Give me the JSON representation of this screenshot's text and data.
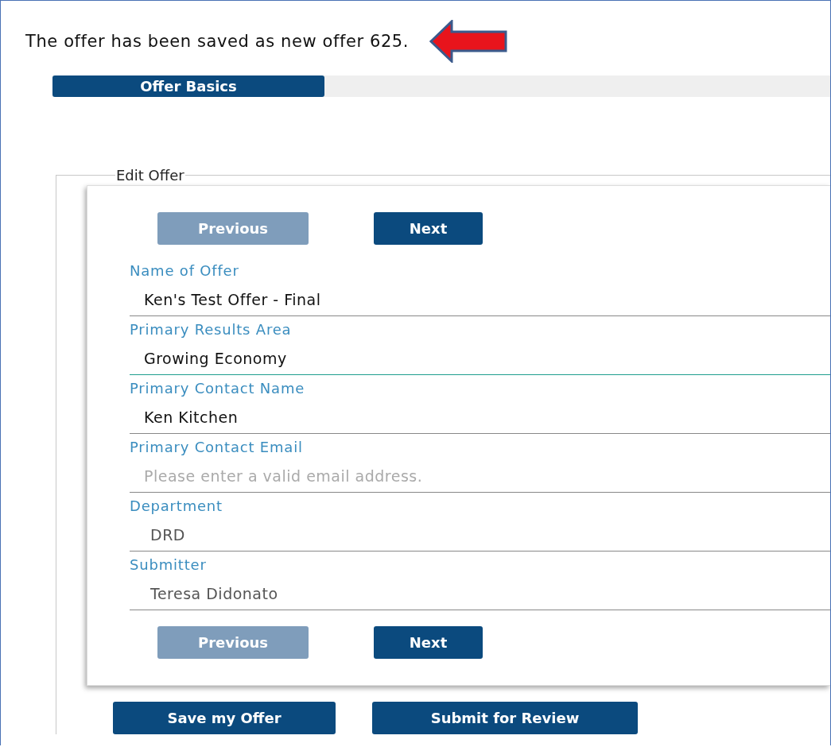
{
  "message": "The offer has been saved as new offer 625.",
  "tabs": [
    {
      "label": "Offer Basics",
      "selected": true
    }
  ],
  "form": {
    "legend": "Edit Offer",
    "top_nav": [
      {
        "label": "Previous",
        "disabled": true
      },
      {
        "label": "Next",
        "disabled": false
      }
    ],
    "fields": [
      {
        "label": "Name of Offer",
        "value": "Ken's Test Offer - Final",
        "focused": false,
        "disabled": false
      },
      {
        "label": "Primary Results Area",
        "value": "Growing Economy",
        "focused": true,
        "disabled": false
      },
      {
        "label": "Primary Contact Name",
        "value": "Ken Kitchen",
        "focused": false,
        "disabled": false
      },
      {
        "label": "Primary Contact Email",
        "placeholder": "Please enter a valid email address.",
        "focused": false,
        "disabled": false
      },
      {
        "label": "Department",
        "value": "DRD",
        "focused": false,
        "disabled": true
      },
      {
        "label": "Submitter",
        "value": "Teresa Didonato",
        "focused": false,
        "disabled": true
      }
    ],
    "bottom_nav": [
      {
        "label": "Previous",
        "disabled": true
      },
      {
        "label": "Next",
        "disabled": false
      }
    ]
  },
  "actions": [
    {
      "label": "Save my Offer"
    },
    {
      "label": "Submit for Review"
    }
  ]
}
